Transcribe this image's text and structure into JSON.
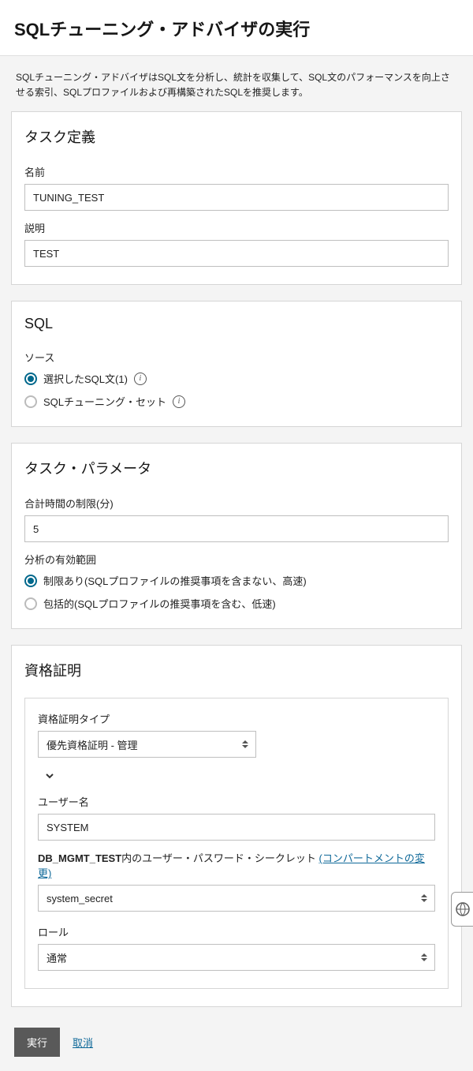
{
  "page": {
    "title": "SQLチューニング・アドバイザの実行",
    "intro": "SQLチューニング・アドバイザはSQL文を分析し、統計を収集して、SQL文のパフォーマンスを向上させる索引、SQLプロファイルおよび再構築されたSQLを推奨します。"
  },
  "task_def": {
    "heading": "タスク定義",
    "name_label": "名前",
    "name_value": "TUNING_TEST",
    "desc_label": "説明",
    "desc_value": "TEST"
  },
  "sql": {
    "heading": "SQL",
    "source_label": "ソース",
    "option_selected": "選択したSQL文(1)",
    "option_tuningset": "SQLチューニング・セット"
  },
  "params": {
    "heading": "タスク・パラメータ",
    "time_limit_label": "合計時間の制限(分)",
    "time_limit_value": "5",
    "scope_label": "分析の有効範囲",
    "scope_limited": "制限あり(SQLプロファイルの推奨事項を含まない、高速)",
    "scope_comprehensive": "包括的(SQLプロファイルの推奨事項を含む、低速)"
  },
  "credentials": {
    "heading": "資格証明",
    "type_label": "資格証明タイプ",
    "type_value": "優先資格証明 - 管理",
    "username_label": "ユーザー名",
    "username_value": "SYSTEM",
    "db_name": "DB_MGMT_TEST",
    "secret_text": "内のユーザー・パスワード・シークレット ",
    "change_compartment": "(コンパートメントの変更)",
    "secret_value": "system_secret",
    "role_label": "ロール",
    "role_value": "通常"
  },
  "footer": {
    "run": "実行",
    "cancel": "取消"
  }
}
